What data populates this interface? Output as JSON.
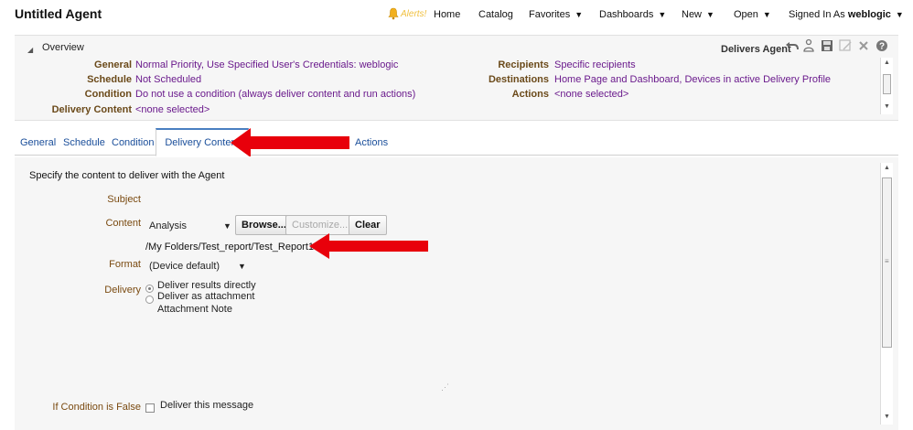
{
  "app_title": "Untitled Agent",
  "alert_text": "Alerts!",
  "nav": {
    "home": "Home",
    "catalog": "Catalog",
    "favorites": "Favorites",
    "dashboards": "Dashboards",
    "new": "New",
    "open": "Open",
    "signed_in_as": "Signed In As",
    "user": "weblogic"
  },
  "overview": {
    "title": "Overview",
    "delivers_label": "Delivers Agent",
    "rows_left": [
      {
        "label": "General",
        "value": "Normal Priority, Use Specified User's Credentials: weblogic"
      },
      {
        "label": "Schedule",
        "value": "Not Scheduled"
      },
      {
        "label": "Condition",
        "value": "Do not use a condition (always deliver content and run actions)"
      },
      {
        "label": "Delivery Content",
        "value": "<none selected>"
      }
    ],
    "rows_right": [
      {
        "label": "Recipients",
        "value": "Specific recipients"
      },
      {
        "label": "Destinations",
        "value": "Home Page and Dashboard, Devices in active Delivery Profile"
      },
      {
        "label": "Actions",
        "value": "<none selected>"
      }
    ]
  },
  "tabs": {
    "general": "General",
    "schedule": "Schedule",
    "condition": "Condition",
    "delivery_content": "Delivery Content",
    "actions": "Actions"
  },
  "panel": {
    "instructions": "Specify the content to deliver with the Agent",
    "subject_label": "Subject",
    "content_label": "Content",
    "content_value": "Analysis",
    "browse": "Browse...",
    "customize": "Customize...",
    "clear": "Clear",
    "path": "/My Folders/Test_report/Test_Report1",
    "format_label": "Format",
    "format_value": "(Device default)",
    "delivery_label": "Delivery",
    "delivery_opt1": "Deliver results directly",
    "delivery_opt2": "Deliver as attachment",
    "attachment_note": "Attachment Note",
    "if_condition_label": "If Condition is False",
    "deliver_message": "Deliver this message"
  },
  "colors": {
    "annotation_arrow": "#e8000b",
    "link_blue": "#1a4e9a",
    "value_purple": "#6a1a8c",
    "label_brown": "#6b4a1a"
  }
}
